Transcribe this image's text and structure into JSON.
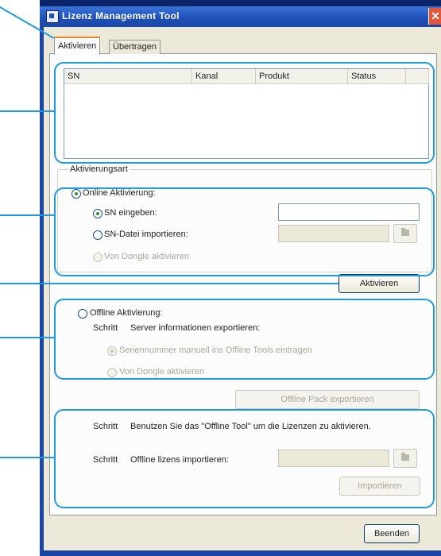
{
  "window": {
    "title": "Lizenz Management Tool",
    "close_glyph": "✕"
  },
  "tabs": [
    {
      "label": "Aktivieren"
    },
    {
      "label": "Übertragen"
    }
  ],
  "list": {
    "columns": [
      "SN",
      "Kanal",
      "Produkt",
      "Status"
    ]
  },
  "activation_type": {
    "group_label": "Aktivierungsart",
    "online_label": "Online Aktivierung:",
    "sn_input_label": "SN eingeben:",
    "sn_file_label": "SN-Datei importieren:",
    "dongle_label": "Von Dongle aktivieren"
  },
  "activate_button": "Aktivieren",
  "offline": {
    "label": "Offline Aktivierung:",
    "step1_prefix": "Schritt",
    "step1_text": "Server informationen exportieren:",
    "option_serial": "Seriennummer manuell ins Offline Tools eintragen",
    "option_dongle": "Von Dongle aktivieren",
    "export_button": "Offline Pack exportieren",
    "step2_prefix": "Schritt",
    "step2_text": "Benutzen Sie das \"Offline Tool\" um die Lizenzen zu aktivieren.",
    "step3_prefix": "Schritt",
    "step3_text": "Offline lizens importieren:",
    "import_button": "Importieren"
  },
  "close_button": "Beenden",
  "colors": {
    "highlight": "#1e9be0",
    "titlebar": "#1f4fb6",
    "dialog_bg": "#ece9d8"
  }
}
